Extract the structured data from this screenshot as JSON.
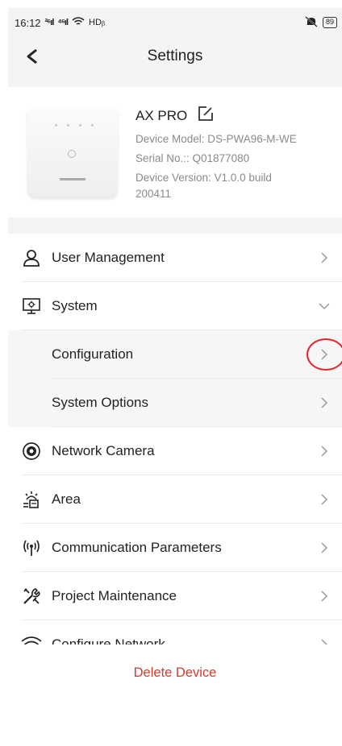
{
  "status_bar": {
    "time": "16:12",
    "signal1": "²⁶ıl",
    "signal2": "⁴⁶ıl",
    "network": "HDᵦ",
    "battery": "89"
  },
  "header": {
    "title": "Settings",
    "back_icon": "back-chevron"
  },
  "device": {
    "name": "AX PRO",
    "model": "Device Model: DS-PWA96-M-WE",
    "serial": "Serial No.:: Q01877080",
    "version": "Device Version: V1.0.0 build 200411"
  },
  "menu": [
    {
      "id": "user-management",
      "label": "User Management",
      "icon": "user-icon",
      "chevron": "right"
    },
    {
      "id": "system",
      "label": "System",
      "icon": "monitor-icon",
      "chevron": "down"
    },
    {
      "id": "configuration",
      "label": "Configuration",
      "sub": true,
      "chevron": "right",
      "highlighted": true
    },
    {
      "id": "system-options",
      "label": "System Options",
      "sub": true,
      "chevron": "right"
    },
    {
      "id": "network-camera",
      "label": "Network Camera",
      "icon": "camera-icon",
      "chevron": "right"
    },
    {
      "id": "area",
      "label": "Area",
      "icon": "area-icon",
      "chevron": "right"
    },
    {
      "id": "communication-parameters",
      "label": "Communication Parameters",
      "icon": "antenna-icon",
      "chevron": "right"
    },
    {
      "id": "project-maintenance",
      "label": "Project Maintenance",
      "icon": "tools-icon",
      "chevron": "right"
    },
    {
      "id": "configure-network",
      "label": "Configure Network",
      "icon": "wifi-icon",
      "chevron": "right"
    }
  ],
  "delete_label": "Delete Device",
  "colors": {
    "accent_red": "#e3262b",
    "delete_text": "#d43b2a",
    "background": "#f4f4f4"
  }
}
